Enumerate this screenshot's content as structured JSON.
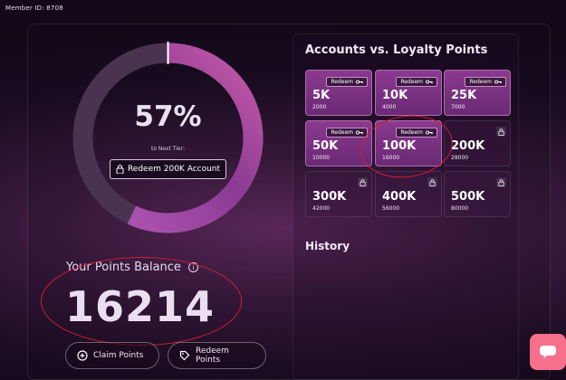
{
  "header": {
    "member_id": "Member ID: 8708"
  },
  "progress": {
    "percent_text": "57%",
    "fraction": 0.57,
    "next_tier_label": "to Next Tier:",
    "redeem_button": "Redeem 200K Account"
  },
  "balance": {
    "title": "Your Points Balance",
    "value": "16214",
    "info_icon": "i"
  },
  "actions": {
    "claim": "Claim Points",
    "redeem": "Redeem Points"
  },
  "accounts": {
    "title": "Accounts vs. Loyalty Points",
    "redeem_label": "Redeem",
    "tiles": [
      {
        "tier": "5K",
        "points": "2000",
        "unlocked": true
      },
      {
        "tier": "10K",
        "points": "4000",
        "unlocked": true
      },
      {
        "tier": "25K",
        "points": "7000",
        "unlocked": true
      },
      {
        "tier": "50K",
        "points": "10000",
        "unlocked": true
      },
      {
        "tier": "100K",
        "points": "16000",
        "unlocked": true
      },
      {
        "tier": "200K",
        "points": "28000",
        "unlocked": false
      },
      {
        "tier": "300K",
        "points": "42000",
        "unlocked": false
      },
      {
        "tier": "400K",
        "points": "56000",
        "unlocked": false
      },
      {
        "tier": "500K",
        "points": "80000",
        "unlocked": false
      }
    ]
  },
  "history": {
    "title": "History"
  },
  "colors": {
    "accent": "#a34aa6",
    "annotation": "#d21d2e",
    "chat": "#f66f8b"
  },
  "icons": {
    "plus": "plus-circle-icon",
    "tag": "tag-icon",
    "lock": "lock-icon",
    "key": "key-icon",
    "chat": "chat-icon"
  }
}
